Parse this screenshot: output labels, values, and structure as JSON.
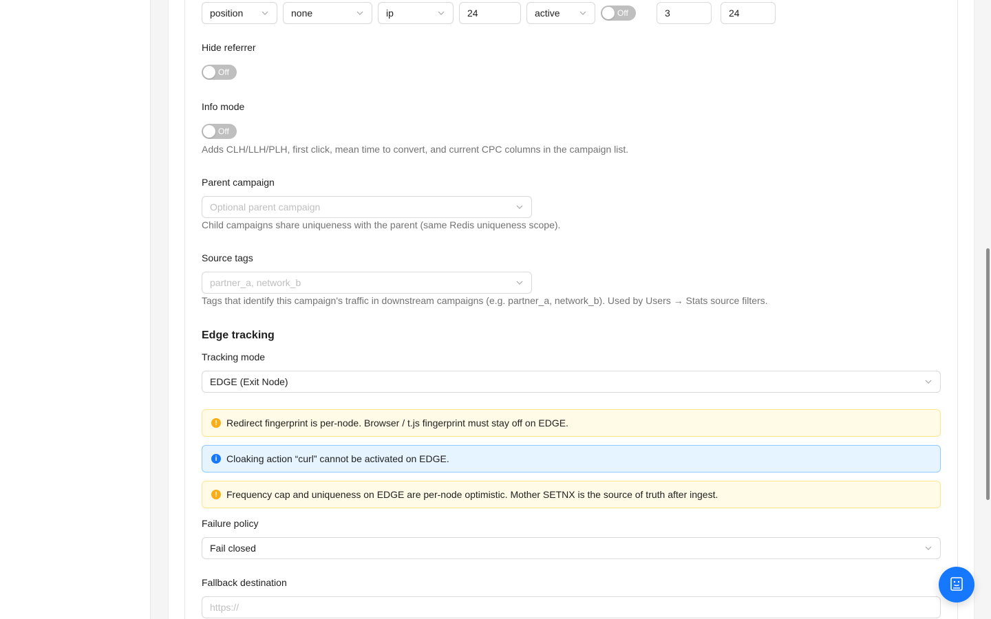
{
  "colors": {
    "primary": "#1677ff",
    "warning": "#faad14",
    "switch_off": "#bfbfbf"
  },
  "top_row": {
    "fields": [
      {
        "value": "position",
        "kind": "select"
      },
      {
        "value": "none",
        "kind": "select"
      },
      {
        "value": "ip",
        "kind": "select"
      },
      {
        "value": "24",
        "kind": "input"
      },
      {
        "value": "active",
        "kind": "select"
      },
      {
        "value": "3",
        "kind": "input"
      },
      {
        "value": "24",
        "kind": "input"
      }
    ],
    "switch_label": "Off"
  },
  "hide_referrer": {
    "label": "Hide referrer",
    "switch_label": "Off"
  },
  "info_mode": {
    "label": "Info mode",
    "switch_label": "Off",
    "help": "Adds CLH/LLH/PLH, first click, mean time to convert, and current CPC columns in the campaign list."
  },
  "parent_campaign": {
    "label": "Parent campaign",
    "placeholder": "Optional parent campaign",
    "help": "Child campaigns share uniqueness with the parent (same Redis uniqueness scope)."
  },
  "source_tags": {
    "label": "Source tags",
    "placeholder": "partner_a, network_b",
    "help": "Tags that identify this campaign's traffic in downstream campaigns (e.g. partner_a, network_b). Used by Users → Stats source filters."
  },
  "edge_tracking": {
    "title": "Edge tracking",
    "tracking_mode_label": "Tracking mode",
    "tracking_mode_value": "EDGE (Exit Node)",
    "alerts": [
      {
        "type": "warning",
        "icon": "exclamation-icon",
        "text": "Redirect fingerprint is per-node. Browser / t.js fingerprint must stay off on EDGE."
      },
      {
        "type": "info",
        "icon": "info-icon",
        "text": "Cloaking action “curl” cannot be activated on EDGE."
      },
      {
        "type": "warning",
        "icon": "exclamation-icon",
        "text": "Frequency cap and uniqueness on EDGE are per-node optimistic. Mother SETNX is the source of truth after ingest."
      }
    ],
    "failure_policy_label": "Failure policy",
    "failure_policy_value": "Fail closed",
    "fallback_label": "Fallback destination",
    "fallback_placeholder": "https://"
  },
  "fab": {
    "icon": "assistant-icon"
  }
}
